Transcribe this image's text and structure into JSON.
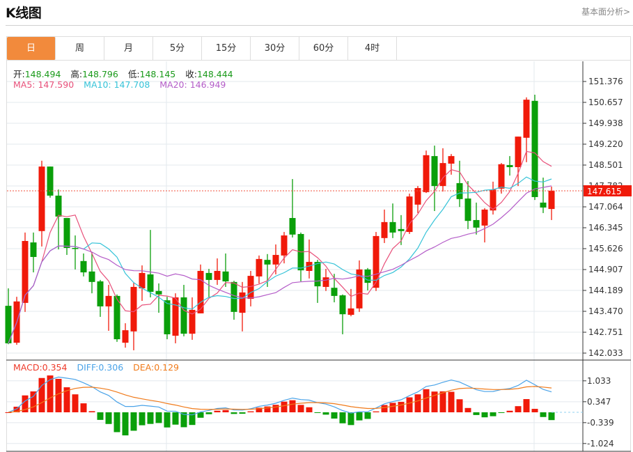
{
  "header": {
    "title": "K线图",
    "link": "基本面分析>"
  },
  "tabs": [
    {
      "label": "日",
      "active": true
    },
    {
      "label": "周"
    },
    {
      "label": "月"
    },
    {
      "label": "5分"
    },
    {
      "label": "15分"
    },
    {
      "label": "30分"
    },
    {
      "label": "60分"
    },
    {
      "label": "4时"
    }
  ],
  "ohlc_info": {
    "open_label": "开:",
    "open": "148.494",
    "high_label": "高:",
    "high": "148.796",
    "low_label": "低:",
    "low": "148.145",
    "close_label": "收:",
    "close": "148.444"
  },
  "ma_info": {
    "ma5": "MA5: 147.590",
    "ma10": "MA10: 147.708",
    "ma20": "MA20: 146.949"
  },
  "macd_info": {
    "macd": "MACD:0.354",
    "diff": "DIFF:0.306",
    "dea": "DEA:0.129"
  },
  "current_price": "147.615",
  "colors": {
    "up": "#f01a0a",
    "down": "#0a9f0a",
    "ma5": "#e8507a",
    "ma10": "#35c3d8",
    "ma20": "#b45cc8",
    "diff": "#4aa3e8",
    "dea": "#f07a1a",
    "accent": "#f28a3c"
  },
  "chart_data": {
    "type": "candlestick",
    "y_ticks": [
      "151.376",
      "150.657",
      "149.938",
      "149.220",
      "148.501",
      "147.782",
      "147.064",
      "146.345",
      "145.626",
      "144.907",
      "144.189",
      "143.470",
      "142.751",
      "142.033"
    ],
    "ylim": [
      142.033,
      151.376
    ],
    "macd_ticks": [
      "1.033",
      "0.347",
      "-0.339",
      "-1.024"
    ],
    "macd_ylim": [
      -1.024,
      1.033
    ],
    "candles": [
      [
        143.66,
        144.26,
        142.34,
        142.37
      ],
      [
        142.39,
        143.97,
        142.32,
        143.81
      ],
      [
        143.76,
        146.18,
        143.45,
        145.89
      ],
      [
        145.84,
        146.18,
        144.81,
        145.34
      ],
      [
        146.23,
        148.65,
        145.7,
        148.45
      ],
      [
        148.45,
        148.45,
        147.38,
        147.45
      ],
      [
        147.45,
        147.66,
        145.6,
        146.73
      ],
      [
        146.68,
        146.68,
        145.41,
        145.65
      ],
      [
        145.65,
        146.08,
        144.91,
        145.63
      ],
      [
        145.2,
        145.46,
        144.67,
        144.81
      ],
      [
        144.84,
        145.51,
        144.09,
        144.48
      ],
      [
        144.5,
        144.55,
        143.28,
        143.64
      ],
      [
        143.64,
        144.38,
        142.8,
        144.0
      ],
      [
        144.0,
        144.05,
        142.42,
        142.51
      ],
      [
        142.39,
        143.06,
        142.22,
        142.82
      ],
      [
        142.78,
        144.45,
        142.13,
        144.31
      ],
      [
        144.26,
        145.05,
        143.83,
        144.79
      ],
      [
        144.74,
        146.27,
        143.95,
        144.14
      ],
      [
        144.17,
        144.43,
        143.42,
        144.05
      ],
      [
        143.85,
        143.97,
        142.51,
        142.68
      ],
      [
        142.63,
        144.09,
        142.37,
        143.95
      ],
      [
        143.95,
        144.38,
        142.61,
        142.7
      ],
      [
        142.7,
        143.95,
        142.49,
        143.52
      ],
      [
        143.4,
        145.08,
        143.4,
        144.86
      ],
      [
        144.79,
        144.93,
        143.95,
        144.55
      ],
      [
        144.55,
        145.29,
        144.38,
        144.86
      ],
      [
        144.84,
        145.46,
        144.31,
        144.5
      ],
      [
        144.48,
        144.52,
        143.18,
        143.45
      ],
      [
        143.42,
        144.48,
        142.78,
        144.12
      ],
      [
        143.9,
        144.86,
        143.64,
        144.69
      ],
      [
        144.67,
        145.39,
        144.43,
        145.27
      ],
      [
        145.24,
        145.44,
        144.31,
        145.08
      ],
      [
        145.08,
        145.77,
        144.74,
        145.41
      ],
      [
        145.39,
        146.2,
        145.12,
        146.08
      ],
      [
        146.68,
        148.02,
        146.01,
        146.11
      ],
      [
        146.13,
        146.18,
        144.5,
        144.88
      ],
      [
        144.86,
        145.94,
        144.6,
        145.17
      ],
      [
        145.17,
        145.24,
        143.76,
        144.33
      ],
      [
        144.31,
        144.93,
        144.17,
        144.64
      ],
      [
        144.28,
        144.76,
        143.78,
        144.0
      ],
      [
        144.02,
        144.05,
        142.68,
        143.37
      ],
      [
        143.35,
        144.24,
        143.3,
        143.57
      ],
      [
        143.57,
        145.22,
        143.45,
        144.91
      ],
      [
        144.91,
        144.96,
        144.19,
        144.45
      ],
      [
        144.28,
        146.2,
        144.17,
        146.06
      ],
      [
        145.99,
        146.97,
        145.82,
        146.54
      ],
      [
        146.54,
        147.18,
        145.99,
        146.18
      ],
      [
        146.3,
        146.78,
        145.75,
        146.23
      ],
      [
        146.2,
        147.52,
        146.13,
        147.42
      ],
      [
        147.14,
        147.78,
        146.85,
        147.71
      ],
      [
        147.57,
        149.0,
        147.54,
        148.84
      ],
      [
        148.81,
        149.17,
        146.92,
        147.78
      ],
      [
        147.78,
        149.08,
        147.59,
        148.57
      ],
      [
        148.55,
        148.88,
        148.17,
        148.81
      ],
      [
        147.88,
        148.65,
        147.06,
        147.33
      ],
      [
        147.35,
        147.95,
        146.3,
        146.58
      ],
      [
        146.61,
        147.21,
        146.11,
        146.35
      ],
      [
        146.42,
        147.02,
        145.84,
        146.97
      ],
      [
        146.94,
        147.93,
        146.8,
        147.66
      ],
      [
        147.69,
        148.57,
        147.52,
        148.53
      ],
      [
        148.5,
        148.81,
        148.14,
        148.43
      ],
      [
        148.43,
        149.48,
        147.78,
        149.48
      ],
      [
        149.44,
        150.83,
        148.6,
        150.75
      ],
      [
        150.71,
        150.92,
        147.3,
        147.4
      ],
      [
        147.21,
        148.07,
        146.85,
        147.04
      ],
      [
        146.99,
        147.76,
        146.61,
        147.62
      ]
    ],
    "candle_format": [
      "open",
      "high",
      "low",
      "close"
    ],
    "indicators": [
      "MA5",
      "MA10",
      "MA20",
      "MACD(12,26,9)"
    ]
  }
}
